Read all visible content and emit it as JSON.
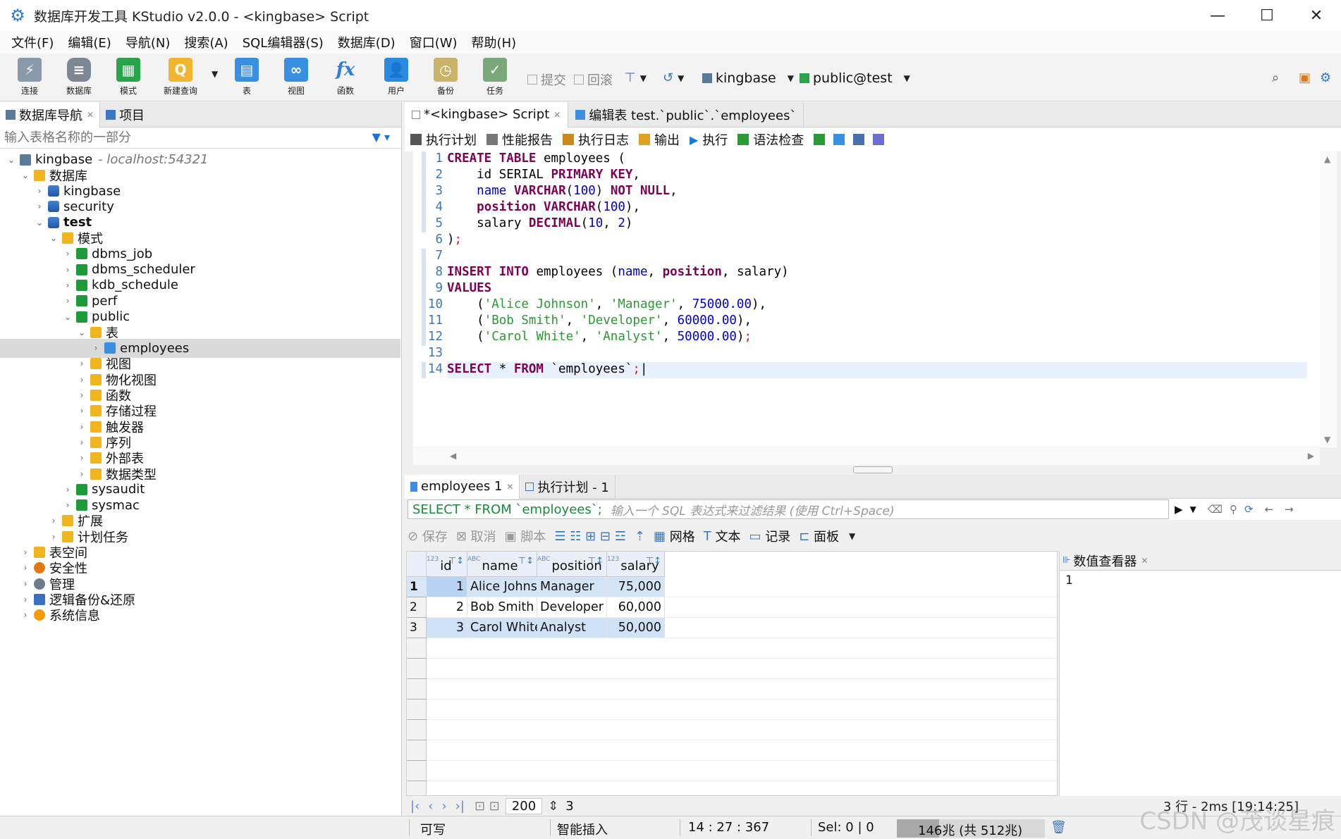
{
  "window": {
    "title": "数据库开发工具 KStudio v2.0.0 - <kingbase> Script",
    "minimize": "—",
    "maximize": "☐",
    "close": "✕"
  },
  "menu": [
    "文件(F)",
    "编辑(E)",
    "导航(N)",
    "搜索(A)",
    "SQL编辑器(S)",
    "数据库(D)",
    "窗口(W)",
    "帮助(H)"
  ],
  "toolbar": {
    "connect": "连接",
    "database": "数据库",
    "schema": "模式",
    "new_query": "新建查询",
    "table": "表",
    "view": "视图",
    "function": "函数",
    "user": "用户",
    "backup": "备份",
    "task": "任务",
    "commit": "提交",
    "rollback": "回滚",
    "connection": "kingbase",
    "schema_sel": "public@test"
  },
  "left": {
    "tab_nav": "数据库导航",
    "tab_project": "项目",
    "filter_placeholder": "输入表格名称的一部分",
    "tree": [
      {
        "label": "kingbase",
        "host": "- localhost:54321",
        "depth": 0,
        "arrow": "⌄",
        "icon": "server"
      },
      {
        "label": "数据库",
        "depth": 1,
        "arrow": "⌄",
        "icon": "folder"
      },
      {
        "label": "kingbase",
        "depth": 2,
        "arrow": "›",
        "icon": "db"
      },
      {
        "label": "security",
        "depth": 2,
        "arrow": "›",
        "icon": "db"
      },
      {
        "label": "test",
        "depth": 2,
        "arrow": "⌄",
        "icon": "db",
        "bold": true
      },
      {
        "label": "模式",
        "depth": 3,
        "arrow": "⌄",
        "icon": "folder"
      },
      {
        "label": "dbms_job",
        "depth": 4,
        "arrow": "›",
        "icon": "schema"
      },
      {
        "label": "dbms_scheduler",
        "depth": 4,
        "arrow": "›",
        "icon": "schema"
      },
      {
        "label": "kdb_schedule",
        "depth": 4,
        "arrow": "›",
        "icon": "schema"
      },
      {
        "label": "perf",
        "depth": 4,
        "arrow": "›",
        "icon": "schema"
      },
      {
        "label": "public",
        "depth": 4,
        "arrow": "⌄",
        "icon": "schema"
      },
      {
        "label": "表",
        "depth": 5,
        "arrow": "⌄",
        "icon": "folder"
      },
      {
        "label": "employees",
        "depth": 6,
        "arrow": "›",
        "icon": "table",
        "selected": true
      },
      {
        "label": "视图",
        "depth": 5,
        "arrow": "›",
        "icon": "folder"
      },
      {
        "label": "物化视图",
        "depth": 5,
        "arrow": "›",
        "icon": "folder"
      },
      {
        "label": "函数",
        "depth": 5,
        "arrow": "›",
        "icon": "folder"
      },
      {
        "label": "存储过程",
        "depth": 5,
        "arrow": "›",
        "icon": "folder"
      },
      {
        "label": "触发器",
        "depth": 5,
        "arrow": "›",
        "icon": "folder"
      },
      {
        "label": "序列",
        "depth": 5,
        "arrow": "›",
        "icon": "folder"
      },
      {
        "label": "外部表",
        "depth": 5,
        "arrow": "›",
        "icon": "folder"
      },
      {
        "label": "数据类型",
        "depth": 5,
        "arrow": "›",
        "icon": "folder"
      },
      {
        "label": "sysaudit",
        "depth": 4,
        "arrow": "›",
        "icon": "schema"
      },
      {
        "label": "sysmac",
        "depth": 4,
        "arrow": "›",
        "icon": "schema"
      },
      {
        "label": "扩展",
        "depth": 3,
        "arrow": "›",
        "icon": "folder"
      },
      {
        "label": "计划任务",
        "depth": 3,
        "arrow": "›",
        "icon": "folder"
      },
      {
        "label": "表空间",
        "depth": 1,
        "arrow": "›",
        "icon": "folder"
      },
      {
        "label": "安全性",
        "depth": 1,
        "arrow": "›",
        "icon": "orange"
      },
      {
        "label": "管理",
        "depth": 1,
        "arrow": "›",
        "icon": "gear"
      },
      {
        "label": "逻辑备份&还原",
        "depth": 1,
        "arrow": "›",
        "icon": "stack"
      },
      {
        "label": "系统信息",
        "depth": 1,
        "arrow": "›",
        "icon": "info"
      }
    ]
  },
  "editor": {
    "tab_script": "*<kingbase> Script",
    "tab_table": "编辑表 test.`public`.`employees`",
    "tools": [
      "执行计划",
      "性能报告",
      "执行日志",
      "输出",
      "执行",
      "语法检查"
    ],
    "line_numbers": [
      "1",
      "2",
      "3",
      "4",
      "5",
      "6",
      "7",
      "8",
      "9",
      "10",
      "11",
      "12",
      "13",
      "14"
    ]
  },
  "results": {
    "tab_result": "employees 1",
    "tab_plan": "执行计划 - 1",
    "query": "SELECT * FROM `employees`;",
    "filter_placeholder": "输入一个 SQL 表达式来过滤结果 (使用 Ctrl+Space)",
    "tools": {
      "save": "保存",
      "cancel": "取消",
      "script": "脚本",
      "grid": "网格",
      "text": "文本",
      "record": "记录",
      "panel": "面板"
    },
    "columns": [
      {
        "name": "id",
        "type": "123"
      },
      {
        "name": "name",
        "type": "ABC"
      },
      {
        "name": "position",
        "type": "ABC"
      },
      {
        "name": "salary",
        "type": "123"
      }
    ],
    "rows": [
      {
        "num": "1",
        "id": "1",
        "name": "Alice Johnson",
        "position": "Manager",
        "salary": "75,000"
      },
      {
        "num": "2",
        "id": "2",
        "name": "Bob Smith",
        "position": "Developer",
        "salary": "60,000"
      },
      {
        "num": "3",
        "id": "3",
        "name": "Carol White",
        "position": "Analyst",
        "salary": "50,000"
      }
    ],
    "value_viewer_title": "数值查看器",
    "value_viewer_value": "1",
    "page_size": "200",
    "row_count": "3",
    "row_stat": "3 行 - 2ms [19:14:25]"
  },
  "status": {
    "mode": "可写",
    "insert": "智能插入",
    "position": "14 : 27 : 367",
    "sel": "Sel: 0 | 0",
    "memory": "146兆 (共 512兆)",
    "memory_fraction": 0.285
  },
  "watermark": "CSDN @茂谈星痕"
}
